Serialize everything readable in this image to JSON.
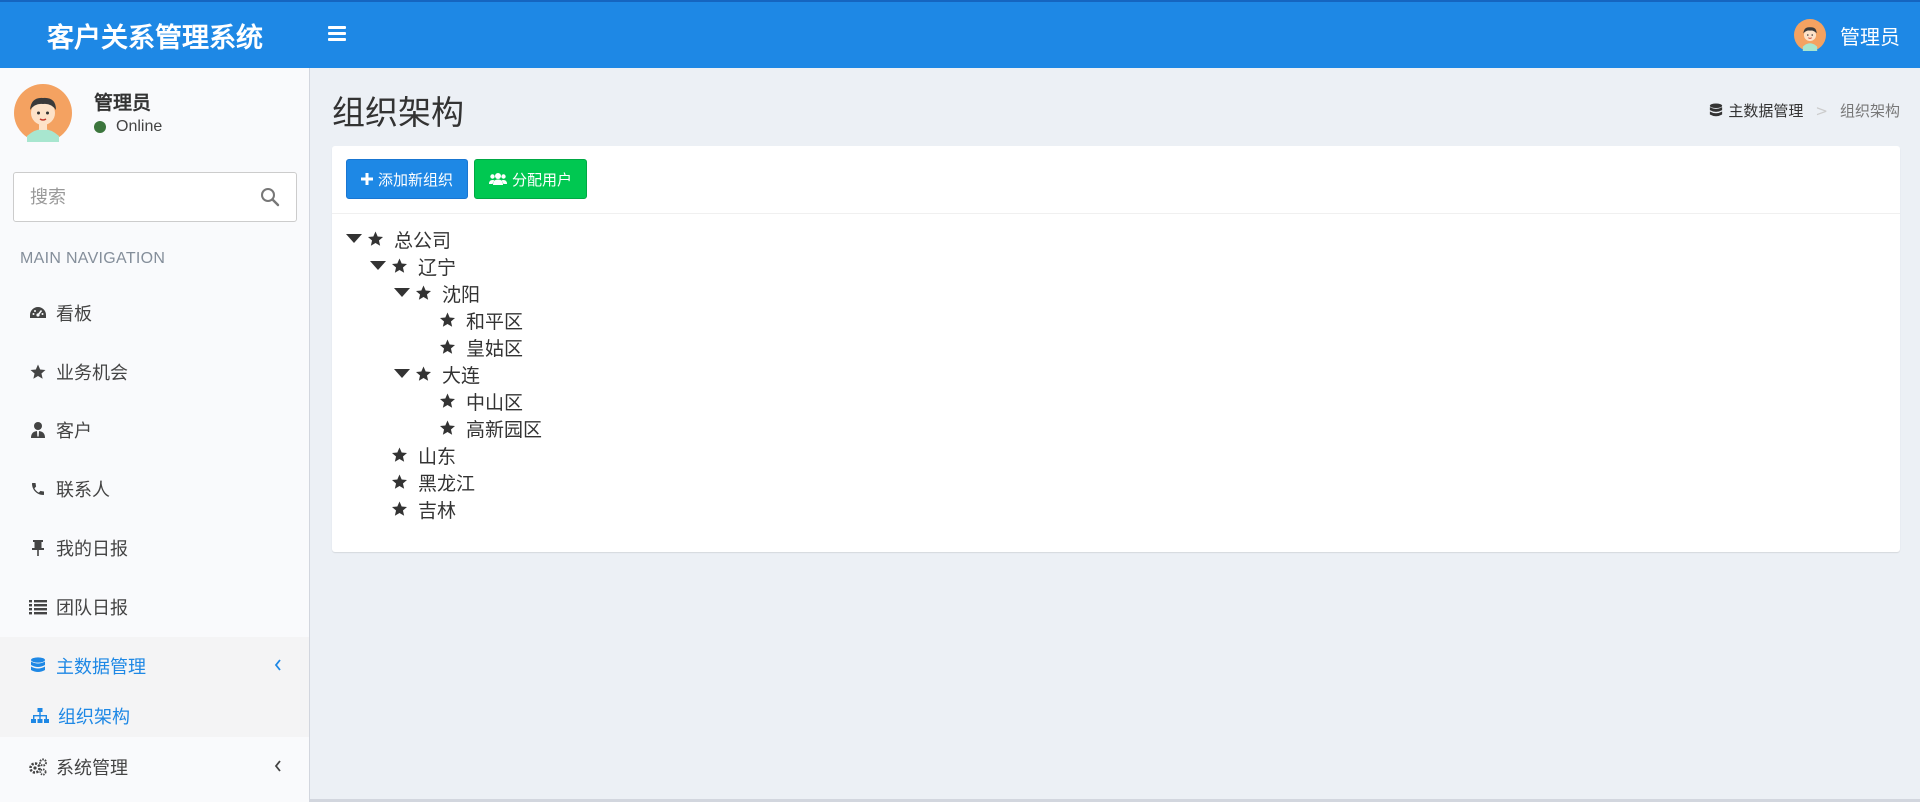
{
  "app": {
    "title": "客户关系管理系统",
    "header_color": "#1e88e5"
  },
  "topbar": {
    "menu_icon": "hamburger-icon",
    "user_name": "管理员"
  },
  "sidebar": {
    "user": {
      "name": "管理员",
      "status": "Online",
      "status_color": "#3c763d"
    },
    "search": {
      "placeholder": "搜索",
      "value": ""
    },
    "nav_header": "MAIN NAVIGATION",
    "items": [
      {
        "label": "看板",
        "icon": "dashboard-icon"
      },
      {
        "label": "业务机会",
        "icon": "star-icon"
      },
      {
        "label": "客户",
        "icon": "user-tie-icon"
      },
      {
        "label": "联系人",
        "icon": "phone-icon"
      },
      {
        "label": "我的日报",
        "icon": "pushpin-icon"
      },
      {
        "label": "团队日报",
        "icon": "list-icon"
      },
      {
        "label": "主数据管理",
        "icon": "database-icon",
        "expanded": true
      },
      {
        "label": "组织架构",
        "icon": "sitemap-icon",
        "active": true
      },
      {
        "label": "系统管理",
        "icon": "cogs-icon"
      }
    ]
  },
  "content": {
    "title": "组织架构",
    "breadcrumb": [
      {
        "label": "主数据管理",
        "icon": "database-icon"
      },
      {
        "label": "组织架构"
      }
    ],
    "actions": {
      "add_label": "添加新组织",
      "assign_label": "分配用户"
    },
    "tree": [
      {
        "label": "总公司",
        "expanded": true
      },
      {
        "label": "辽宁",
        "expanded": true
      },
      {
        "label": "沈阳",
        "expanded": true
      },
      {
        "label": "和平区"
      },
      {
        "label": "皇姑区"
      },
      {
        "label": "大连",
        "expanded": true
      },
      {
        "label": "中山区"
      },
      {
        "label": "高新园区"
      },
      {
        "label": "山东"
      },
      {
        "label": "黑龙江"
      },
      {
        "label": "吉林"
      }
    ]
  }
}
